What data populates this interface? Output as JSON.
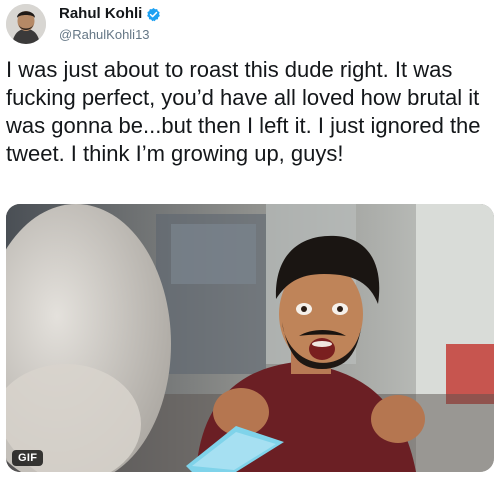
{
  "tweet": {
    "author": {
      "display_name": "Rahul Kohli",
      "handle": "@RahulKohli13",
      "verified": true,
      "avatar_icon": "avatar-photo"
    },
    "text": "I was just about to roast this dude right. It was fucking perfect, you’d have all loved how brutal it was gonna be...but then I left it. I just ignored the tweet. I think I’m growing up, guys!",
    "media": {
      "type": "gif",
      "badge_label": "GIF"
    }
  },
  "colors": {
    "text": "#14171a",
    "secondary": "#657786",
    "verified": "#1da1f2"
  }
}
